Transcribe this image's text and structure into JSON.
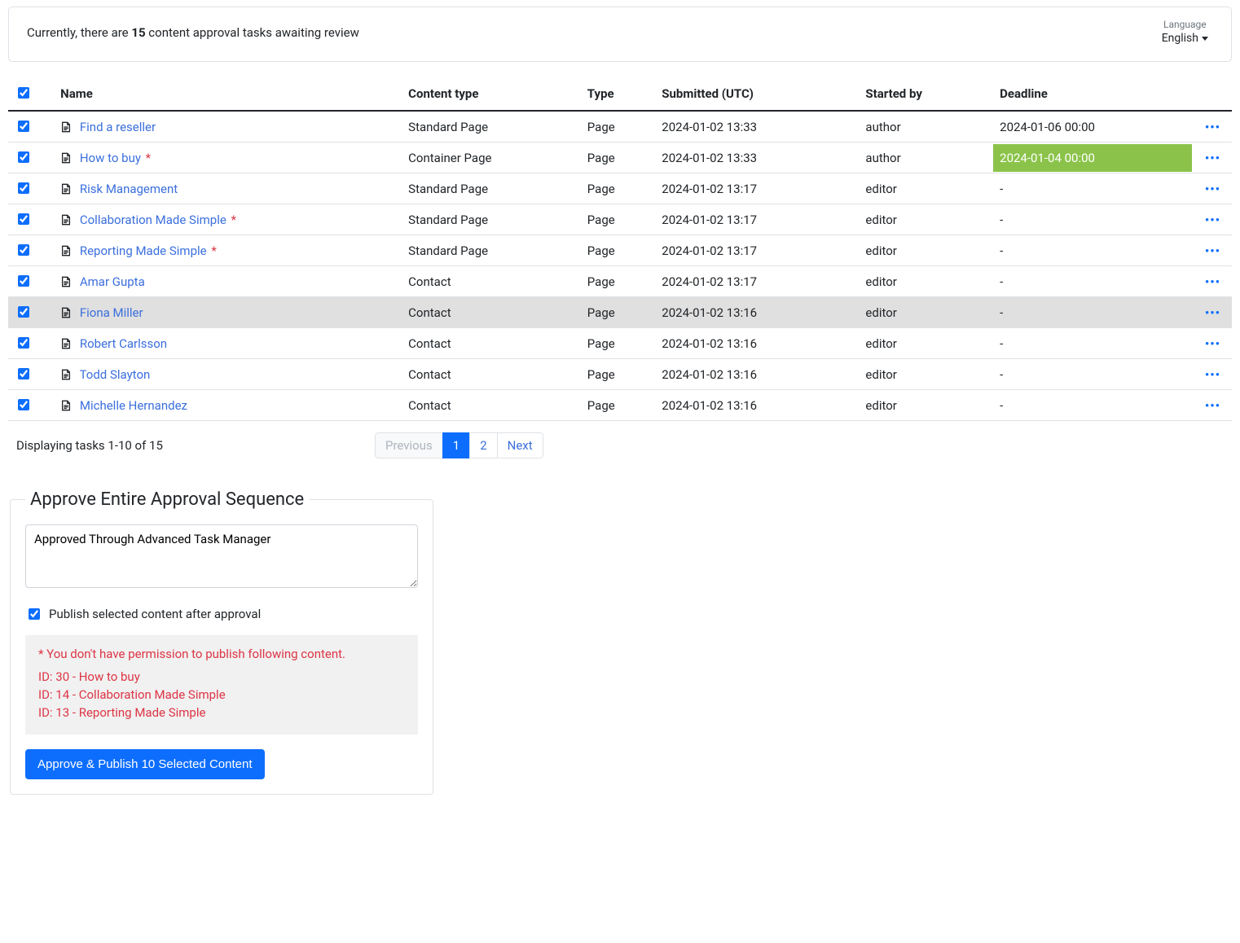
{
  "header": {
    "summary_prefix": "Currently, there are ",
    "task_count": "15",
    "summary_suffix": " content approval tasks awaiting review",
    "language_label": "Language",
    "language_value": "English"
  },
  "table": {
    "columns": {
      "name": "Name",
      "content_type": "Content type",
      "type": "Type",
      "submitted": "Submitted (UTC)",
      "started_by": "Started by",
      "deadline": "Deadline"
    },
    "rows": [
      {
        "checked": true,
        "name": "Find a reseller",
        "flag": false,
        "content_type": "Standard Page",
        "type": "Page",
        "submitted": "2024-01-02 13:33",
        "started_by": "author",
        "deadline": "2024-01-06 00:00",
        "deadline_highlight": false,
        "shaded": false
      },
      {
        "checked": true,
        "name": "How to buy",
        "flag": true,
        "content_type": "Container Page",
        "type": "Page",
        "submitted": "2024-01-02 13:33",
        "started_by": "author",
        "deadline": "2024-01-04 00:00",
        "deadline_highlight": true,
        "shaded": false
      },
      {
        "checked": true,
        "name": "Risk Management",
        "flag": false,
        "content_type": "Standard Page",
        "type": "Page",
        "submitted": "2024-01-02 13:17",
        "started_by": "editor",
        "deadline": "-",
        "deadline_highlight": false,
        "shaded": false
      },
      {
        "checked": true,
        "name": "Collaboration Made Simple",
        "flag": true,
        "content_type": "Standard Page",
        "type": "Page",
        "submitted": "2024-01-02 13:17",
        "started_by": "editor",
        "deadline": "-",
        "deadline_highlight": false,
        "shaded": false
      },
      {
        "checked": true,
        "name": "Reporting Made Simple",
        "flag": true,
        "content_type": "Standard Page",
        "type": "Page",
        "submitted": "2024-01-02 13:17",
        "started_by": "editor",
        "deadline": "-",
        "deadline_highlight": false,
        "shaded": false
      },
      {
        "checked": true,
        "name": "Amar Gupta",
        "flag": false,
        "content_type": "Contact",
        "type": "Page",
        "submitted": "2024-01-02 13:17",
        "started_by": "editor",
        "deadline": "-",
        "deadline_highlight": false,
        "shaded": false
      },
      {
        "checked": true,
        "name": "Fiona Miller",
        "flag": false,
        "content_type": "Contact",
        "type": "Page",
        "submitted": "2024-01-02 13:16",
        "started_by": "editor",
        "deadline": "-",
        "deadline_highlight": false,
        "shaded": true
      },
      {
        "checked": true,
        "name": "Robert Carlsson",
        "flag": false,
        "content_type": "Contact",
        "type": "Page",
        "submitted": "2024-01-02 13:16",
        "started_by": "editor",
        "deadline": "-",
        "deadline_highlight": false,
        "shaded": false
      },
      {
        "checked": true,
        "name": "Todd Slayton",
        "flag": false,
        "content_type": "Contact",
        "type": "Page",
        "submitted": "2024-01-02 13:16",
        "started_by": "editor",
        "deadline": "-",
        "deadline_highlight": false,
        "shaded": false
      },
      {
        "checked": true,
        "name": "Michelle Hernandez",
        "flag": false,
        "content_type": "Contact",
        "type": "Page",
        "submitted": "2024-01-02 13:16",
        "started_by": "editor",
        "deadline": "-",
        "deadline_highlight": false,
        "shaded": false
      }
    ]
  },
  "pager": {
    "status": "Displaying tasks 1-10 of 15",
    "previous": "Previous",
    "next": "Next",
    "pages": [
      "1",
      "2"
    ],
    "active_index": 0
  },
  "approval": {
    "legend": "Approve Entire Approval Sequence",
    "comment_value": "Approved Through Advanced Task Manager",
    "publish_checkbox_label": "Publish selected content after approval",
    "publish_checked": true,
    "warning": {
      "heading": "* You don't have permission to publish following content.",
      "items": [
        "ID: 30 - How to buy",
        "ID: 14 - Collaboration Made Simple",
        "ID: 13 - Reporting Made Simple"
      ]
    },
    "button_label": "Approve & Publish 10 Selected Content"
  },
  "glyphs": {
    "flag": "*",
    "row_actions": "•••"
  }
}
